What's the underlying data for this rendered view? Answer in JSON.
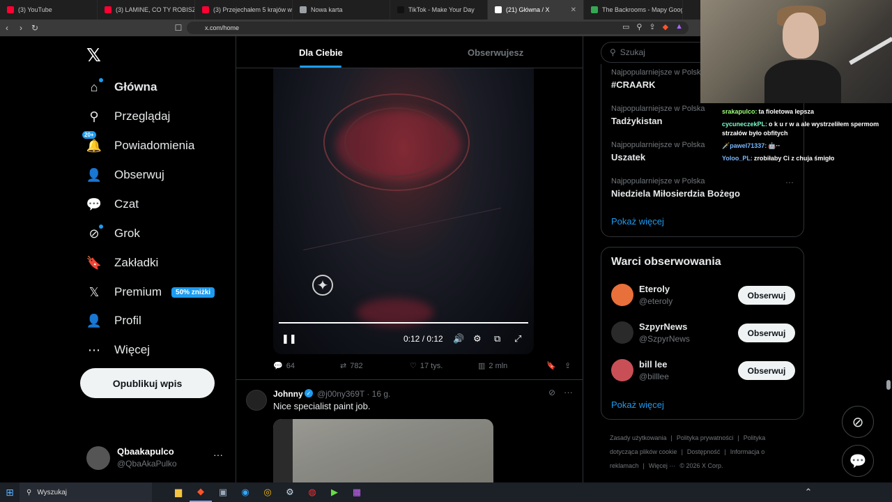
{
  "browser": {
    "tabs": [
      {
        "title": "(3) YouTube",
        "color": "#ff0033",
        "active": false
      },
      {
        "title": "(3) LAMINE, CO TY ROBISZ? Z",
        "color": "#ff0033",
        "active": false
      },
      {
        "title": "(3) Przejechałem 5 krajów w 7",
        "color": "#ff0033",
        "active": false
      },
      {
        "title": "Nowa karta",
        "color": "#9aa0a6",
        "active": false
      },
      {
        "title": "TikTok - Make Your Day",
        "color": "#111111",
        "active": false
      },
      {
        "title": "(21) Główna / X",
        "color": "#ffffff",
        "active": true
      },
      {
        "title": "The Backrooms - Mapy Goog",
        "color": "#34a853",
        "active": false
      }
    ],
    "url": "x.com/home"
  },
  "leftnav": {
    "logo": "𝕏",
    "items": [
      {
        "label": "Główna",
        "icon": "home-icon",
        "glyph": "⌂"
      },
      {
        "label": "Przeglądaj",
        "icon": "search-icon",
        "glyph": "⚲"
      },
      {
        "label": "Powiadomienia",
        "icon": "bell-icon",
        "glyph": "🔔"
      },
      {
        "label": "Obserwuj",
        "icon": "follow-icon",
        "glyph": "👤"
      },
      {
        "label": "Czat",
        "icon": "chat-icon",
        "glyph": "💬"
      },
      {
        "label": "Grok",
        "icon": "grok-icon",
        "glyph": "⊘"
      },
      {
        "label": "Zakładki",
        "icon": "bookmark-icon",
        "glyph": "🔖"
      },
      {
        "label": "Premium",
        "icon": "x-premium-icon",
        "glyph": "𝕏"
      },
      {
        "label": "Profil",
        "icon": "profile-icon",
        "glyph": "👤"
      },
      {
        "label": "Więcej",
        "icon": "more-icon",
        "glyph": "⋯"
      }
    ],
    "notifications_badge": "20+",
    "premium_badge": "50% zniżki",
    "post_button": "Opublikuj wpis",
    "profile": {
      "name": "Qbaakapulco",
      "handle": "@QbaAkaPulko",
      "more": "···"
    }
  },
  "feed": {
    "tabs": {
      "for_you": "Dla Ciebie",
      "following": "Obserwujesz"
    },
    "video": {
      "time": "0:12 / 0:12",
      "progress": 1.0
    },
    "actions": {
      "replies": "64",
      "reposts": "782",
      "likes": "17 tys.",
      "views": "2 mln"
    },
    "tweet2": {
      "name": "Johnny",
      "handle_time": "@j00ny369T · 16 g.",
      "text": "Nice specialist paint job.",
      "more": "···"
    }
  },
  "right": {
    "search_placeholder": "Szukaj",
    "trends": [
      {
        "context": "Najpopularniejsze w Polska",
        "name": "#CRAARK"
      },
      {
        "context": "Najpopularniejsze w Polska",
        "name": "Tadżykistan"
      },
      {
        "context": "Najpopularniejsze w Polska",
        "name": "Uszatek"
      },
      {
        "context": "Najpopularniejsze w Polska",
        "name": "Niedziela Miłosierdzia Bożego"
      }
    ],
    "trend_more": "···",
    "show_more": "Pokaż więcej",
    "who_to_follow": {
      "title": "Warci obserwowania",
      "accounts": [
        {
          "name": "Eteroly",
          "handle": "@eteroly",
          "color": "#e8703a"
        },
        {
          "name": "SzpyrNews",
          "handle": "@SzpyrNews",
          "color": "#2a2a2a"
        },
        {
          "name": "bill lee",
          "handle": "@billlee",
          "color": "#c94f56"
        }
      ],
      "follow_label": "Obserwuj",
      "show_more": "Pokaż więcej"
    },
    "footer": [
      "Zasady użytkowania",
      "|",
      "Polityka prywatności",
      "|",
      "Polityka dotycząca plików cookie",
      "|",
      "Dostępność",
      "|",
      "Informacja o reklamach",
      "|",
      "Więcej ···",
      "© 2026 X Corp."
    ]
  },
  "chat": [
    {
      "user": "srakapulco:",
      "text": "ta fioletowa lepsza",
      "color": "#9dff7a"
    },
    {
      "user": "cycuneczekPL:",
      "text": "o k u r w a ale wystrzeliłem spermom strzałów było obfitych",
      "color": "#7affc8"
    },
    {
      "user": "🗡️pawel71337:",
      "text": "🤖··",
      "color": "#7ab8ff"
    },
    {
      "user": "Yoloo_PL:",
      "text": "zrobiłaby Ci z chuja śmigło",
      "color": "#7ab8ff"
    }
  ],
  "taskbar": {
    "search": "Wyszukaj"
  }
}
